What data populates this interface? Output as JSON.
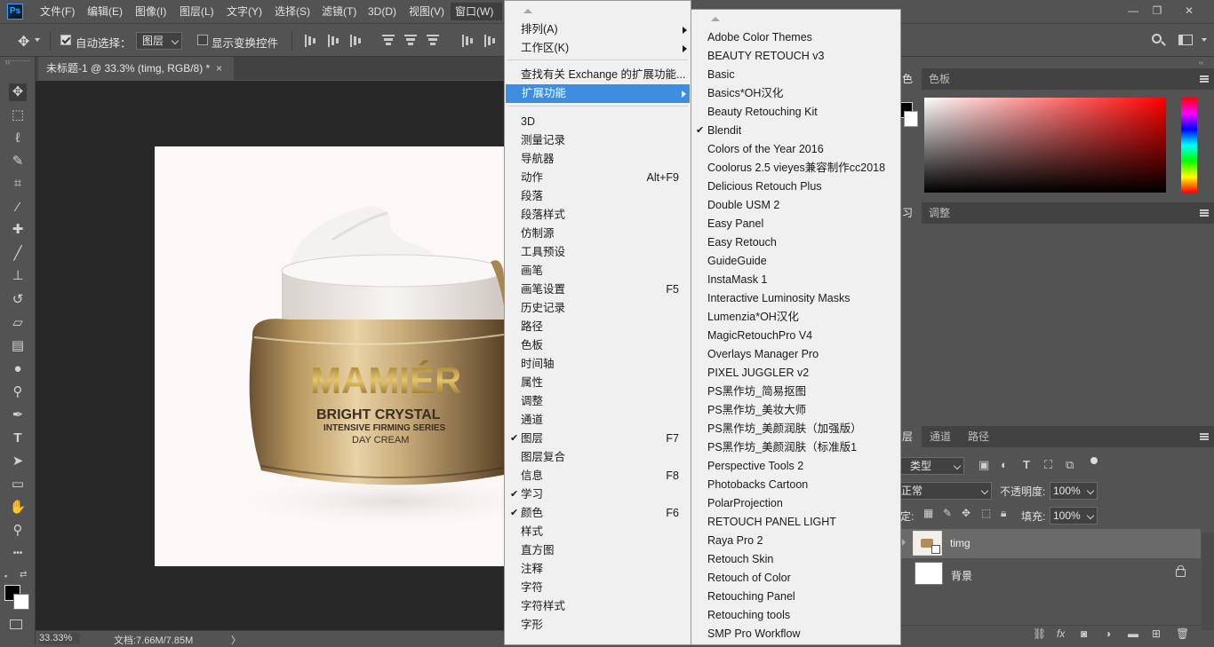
{
  "app": {
    "logo_text": "Ps"
  },
  "menubar": {
    "items": [
      "文件(F)",
      "编辑(E)",
      "图像(I)",
      "图层(L)",
      "文字(Y)",
      "选择(S)",
      "滤镜(T)",
      "3D(D)",
      "视图(V)",
      "窗口(W)"
    ],
    "window_controls": [
      "—",
      "❐",
      "✕"
    ]
  },
  "options": {
    "auto_select_label": "自动选择：",
    "auto_select_value": "图层",
    "show_transform_label": "显示变换控件"
  },
  "document": {
    "tab_title": "未标题-1 @ 33.3% (timg, RGB/8) *",
    "tab_close": "×",
    "product": {
      "brand": "MAMIÉR",
      "line1": "BRIGHT CRYSTAL",
      "line2": "INTENSIVE FIRMING SERIES",
      "line3": "DAY CREAM"
    }
  },
  "status": {
    "zoom": "33.33%",
    "doc_info": "文档:7.66M/7.85M",
    "arrow": "〉"
  },
  "window_menu": {
    "items": [
      {
        "label": "排列(A)",
        "submenu": true
      },
      {
        "label": "工作区(K)",
        "submenu": true
      },
      {
        "label": "查找有关 Exchange 的扩展功能..."
      },
      {
        "label": "扩展功能",
        "submenu": true,
        "highlighted": true
      },
      {
        "label": "3D"
      },
      {
        "label": "测量记录"
      },
      {
        "label": "导航器"
      },
      {
        "label": "动作",
        "shortcut": "Alt+F9"
      },
      {
        "label": "段落"
      },
      {
        "label": "段落样式"
      },
      {
        "label": "仿制源"
      },
      {
        "label": "工具预设"
      },
      {
        "label": "画笔"
      },
      {
        "label": "画笔设置",
        "shortcut": "F5"
      },
      {
        "label": "历史记录"
      },
      {
        "label": "路径"
      },
      {
        "label": "色板"
      },
      {
        "label": "时间轴"
      },
      {
        "label": "属性"
      },
      {
        "label": "调整"
      },
      {
        "label": "通道"
      },
      {
        "label": "图层",
        "shortcut": "F7",
        "checked": true
      },
      {
        "label": "图层复合"
      },
      {
        "label": "信息",
        "shortcut": "F8"
      },
      {
        "label": "学习",
        "checked": true
      },
      {
        "label": "颜色",
        "shortcut": "F6",
        "checked": true
      },
      {
        "label": "样式"
      },
      {
        "label": "直方图"
      },
      {
        "label": "注释"
      },
      {
        "label": "字符"
      },
      {
        "label": "字符样式"
      },
      {
        "label": "字形"
      }
    ],
    "check_glyph": "✔"
  },
  "extensions_menu": {
    "items": [
      {
        "label": "Adobe Color Themes"
      },
      {
        "label": "BEAUTY RETOUCH v3"
      },
      {
        "label": "Basic"
      },
      {
        "label": "Basics*OH汉化"
      },
      {
        "label": "Beauty Retouching Kit"
      },
      {
        "label": "Blendit",
        "checked": true
      },
      {
        "label": "Colors of the Year 2016"
      },
      {
        "label": "Coolorus 2.5 vieyes兼容制作cc2018"
      },
      {
        "label": "Delicious Retouch Plus"
      },
      {
        "label": "Double USM 2"
      },
      {
        "label": "Easy Panel"
      },
      {
        "label": "Easy Retouch"
      },
      {
        "label": "GuideGuide"
      },
      {
        "label": "InstaMask 1"
      },
      {
        "label": "Interactive Luminosity Masks"
      },
      {
        "label": "Lumenzia*OH汉化"
      },
      {
        "label": "MagicRetouchPro V4"
      },
      {
        "label": "Overlays Manager Pro"
      },
      {
        "label": "PIXEL JUGGLER v2"
      },
      {
        "label": "PS黑作坊_简易抠图"
      },
      {
        "label": "PS黑作坊_美妆大师"
      },
      {
        "label": "PS黑作坊_美颜润肤（加强版）"
      },
      {
        "label": "PS黑作坊_美颜润肤（标准版1"
      },
      {
        "label": "Perspective Tools 2"
      },
      {
        "label": "Photobacks Cartoon"
      },
      {
        "label": "PolarProjection"
      },
      {
        "label": "RETOUCH PANEL LIGHT"
      },
      {
        "label": "Raya Pro 2"
      },
      {
        "label": "Retouch Skin"
      },
      {
        "label": "Retouch of Color"
      },
      {
        "label": "Retouching Panel"
      },
      {
        "label": "Retouching tools"
      },
      {
        "label": "SMP Pro Workflow"
      }
    ]
  },
  "panels": {
    "color_tabs": [
      "色",
      "色板"
    ],
    "learn_tabs": [
      "习",
      "调整"
    ],
    "layers_tabs": [
      "层",
      "通道",
      "路径"
    ],
    "filter_kind": "类型",
    "blend_mode": "正常",
    "opacity_label": "不透明度:",
    "opacity_value": "100%",
    "lock_label": "定:",
    "fill_label": "填充:",
    "fill_value": "100%",
    "layers": [
      {
        "name": "timg",
        "selected": true
      },
      {
        "name": "背景",
        "locked": true
      }
    ],
    "bottom_icons": [
      "link-icon",
      "fx-icon",
      "mask-icon",
      "adjustment-icon",
      "group-icon",
      "new-layer-icon",
      "delete-icon"
    ]
  },
  "colors": {
    "highlight": "#3d8ee0",
    "menu_bg": "#f0f0f0",
    "ui_bg": "#535353",
    "canvas_bg": "#282828"
  }
}
